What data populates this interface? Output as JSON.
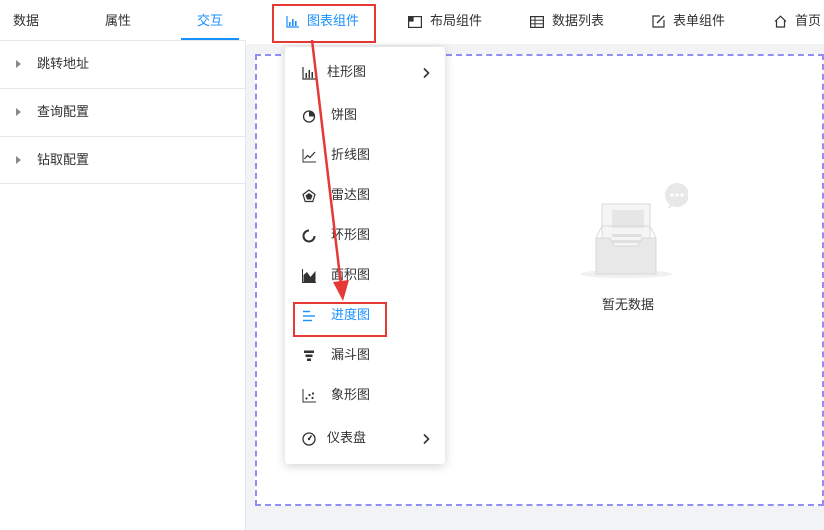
{
  "left_tabs": [
    "数据",
    "属性",
    "交互"
  ],
  "left_panel": {
    "items": [
      "跳转地址",
      "查询配置",
      "钻取配置"
    ]
  },
  "toolbar": {
    "items": [
      "图表组件",
      "布局组件",
      "数据列表",
      "表单组件",
      "首页"
    ]
  },
  "chart_menu": {
    "items": [
      "柱形图",
      "饼图",
      "折线图",
      "雷达图",
      "环形图",
      "面积图",
      "进度图",
      "漏斗图",
      "象形图",
      "仪表盘"
    ],
    "highlighted": "进度图"
  },
  "canvas": {
    "empty_text": "暂无数据"
  },
  "colors": {
    "accent": "#1890ff",
    "annotation_red": "#e53935",
    "canvas_border": "#8e8ef5"
  }
}
